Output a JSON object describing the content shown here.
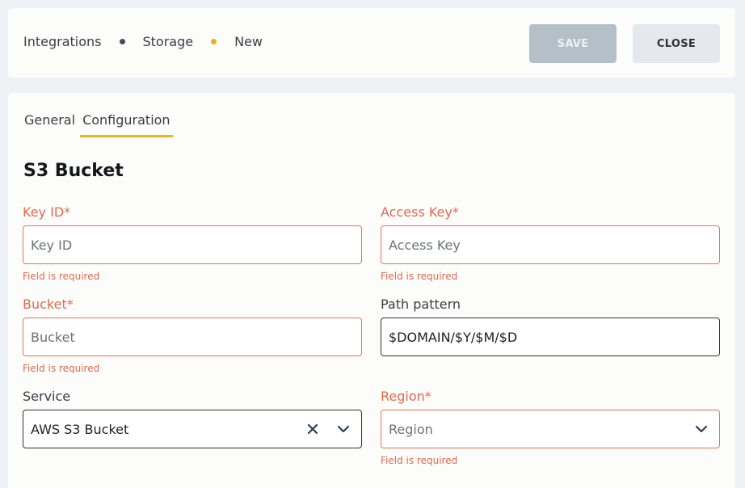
{
  "header": {
    "breadcrumbs": [
      "Integrations",
      "Storage",
      "New"
    ],
    "save_label": "SAVE",
    "close_label": "CLOSE"
  },
  "tabs": [
    "General",
    "Configuration"
  ],
  "active_tab": "Configuration",
  "section_title": "S3 Bucket",
  "fields": {
    "key_id": {
      "label": "Key ID*",
      "placeholder": "Key ID",
      "value": "",
      "error": "Field is required"
    },
    "access_key": {
      "label": "Access Key*",
      "placeholder": "Access Key",
      "value": "",
      "error": "Field is required"
    },
    "bucket": {
      "label": "Bucket*",
      "placeholder": "Bucket",
      "value": "",
      "error": "Field is required"
    },
    "path_pattern": {
      "label": "Path pattern",
      "value": "$DOMAIN/$Y/$M/$D"
    },
    "service": {
      "label": "Service",
      "value": "AWS S3 Bucket"
    },
    "region": {
      "label": "Region*",
      "placeholder": "Region",
      "value": "",
      "error": "Field is required"
    }
  },
  "colors": {
    "accent": "#f0b31a",
    "error": "#e06a4e",
    "storage_dot": "#3b4d6b",
    "save_disabled": "#b5bfc8"
  }
}
